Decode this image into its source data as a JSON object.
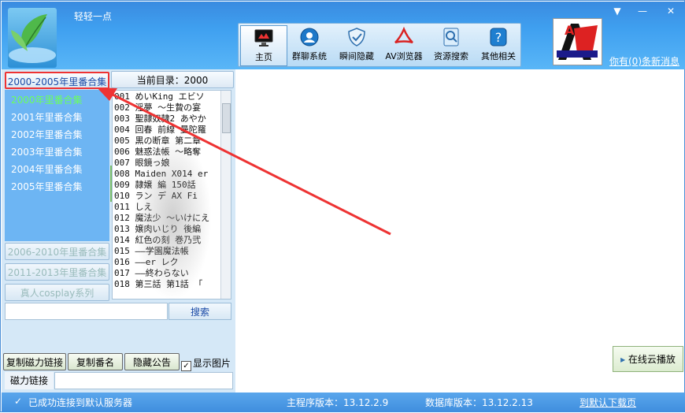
{
  "window": {
    "title": "轻轻一点",
    "minimize_label": "—",
    "close_label": "✕",
    "menu_label": "▼"
  },
  "toolbar": {
    "items": [
      {
        "label": "主页",
        "icon": "monitor-icon"
      },
      {
        "label": "群聊系统",
        "icon": "chat-icon"
      },
      {
        "label": "瞬间隐藏",
        "icon": "shield-icon"
      },
      {
        "label": "AV浏览器",
        "icon": "browser-icon"
      },
      {
        "label": "资源搜索",
        "icon": "search-icon"
      },
      {
        "label": "其他相关",
        "icon": "help-icon"
      }
    ]
  },
  "brand": {
    "text": "A"
  },
  "header": {
    "message_link": "你有(0)条新消息"
  },
  "categories": {
    "group1": "2000-2005年里番合集",
    "group2": "2006-2010年里番合集",
    "group3": "2011-2013年里番合集",
    "group4": "真人cosplay系列",
    "subitems": [
      "2000年里番合集",
      "2001年里番合集",
      "2002年里番合集",
      "2003年里番合集",
      "2004年里番合集",
      "2005年里番合集"
    ]
  },
  "current_dir": "当前目录：2000",
  "files": [
    "001 めいKing エビソ",
    "002 淫夢 ～生贄の宴",
    "003 聖隷奴隷2 あやか",
    "004 回春 前線 曼陀羅",
    "005 黒の断章 第二章",
    "006 魅惑法帳 ～略奪",
    "007 眼鏡っ娘",
    "008 Maiden X014 er",
    "009 隷嬢 編 150話",
    "010 ラン デ AX Fi",
    "011 しえ",
    "012 魔法少 ～いけにえ",
    "013 嬢肉いじり 後編",
    "014 紅色の刻 巻乃弐",
    "015 ——学園魔法帳",
    "016 ——er レク",
    "017 ——終わらない",
    "018 第三話 第1話 「"
  ],
  "search": {
    "button": "搜索",
    "placeholder": ""
  },
  "actions": {
    "copy_magnet": "复制磁力链接",
    "copy_name": "复制番名",
    "hide_notice": "隐藏公告",
    "show_image": "显示图片",
    "show_image_checked": "✓"
  },
  "magnet": {
    "label": "磁力链接",
    "value": ""
  },
  "cloud_play": "在线云播放",
  "status": {
    "connection": "已成功连接到默认服务器",
    "program_version": "主程序版本：13.12.2.9",
    "db_version": "数据库版本：13.12.2.13",
    "download_link": "到默认下载页"
  },
  "colors": {
    "accent": "#3f8ede",
    "subtree_bg": "#6db5f3",
    "selected_item": "#6bff5b",
    "highlight_border": "#ee3333"
  }
}
